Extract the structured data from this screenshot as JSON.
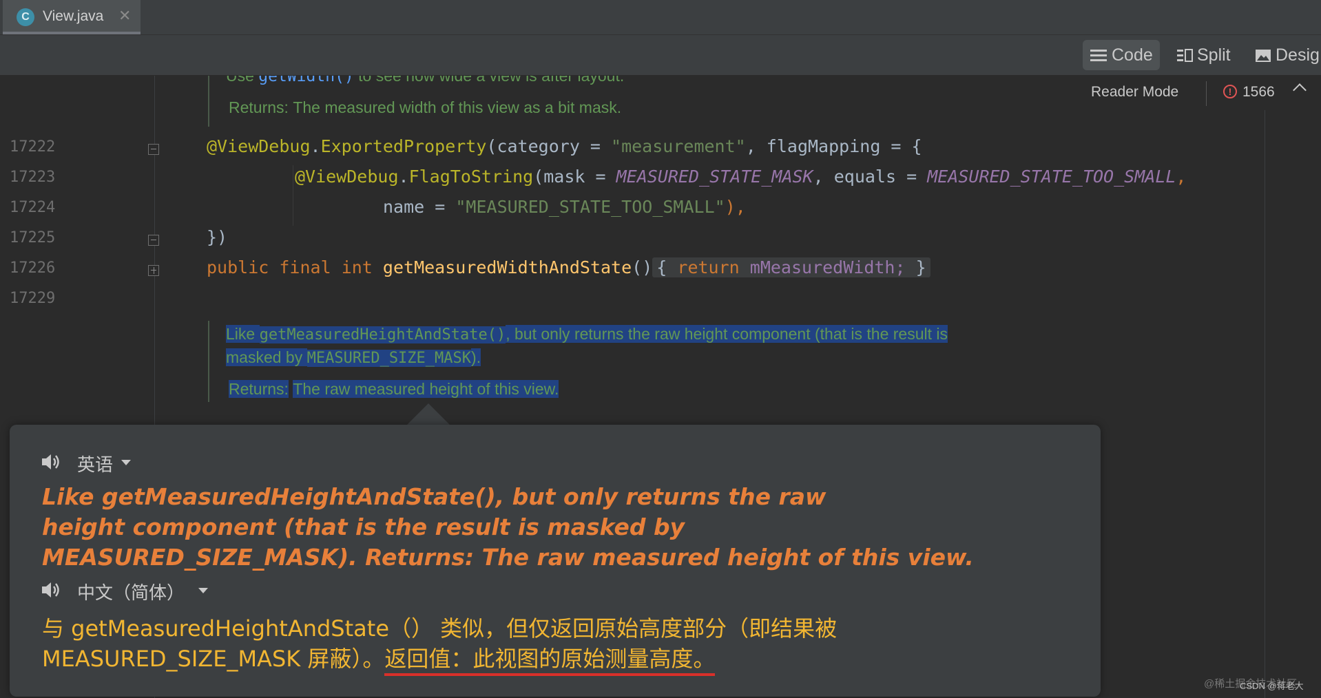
{
  "tab": {
    "icon_letter": "C",
    "label": "View.java",
    "close": "✕"
  },
  "toolbar": {
    "code": "Code",
    "split": "Split",
    "design": "Desig"
  },
  "editor": {
    "reader_mode": "Reader Mode",
    "problems_count": "1566",
    "line_numbers": [
      "17222",
      "17223",
      "17224",
      "17225",
      "17226",
      "17229"
    ],
    "doc_top": {
      "line1_pre": "Use ",
      "line1_link": "getWidth()",
      "line1_post": " to see how wide a view is after layout.",
      "returns_label": "Returns:",
      "returns_text": "The measured width of this view as a bit mask."
    },
    "code": {
      "l1_ann": "@ViewDebug",
      "l1_dot": ".",
      "l1_annname": "ExportedProperty",
      "l1_a": "(category = ",
      "l1_str": "\"measurement\"",
      "l1_b": ", flagMapping = {",
      "l2_ann": "@ViewDebug",
      "l2_dot": ".",
      "l2_annname": "FlagToString",
      "l2_a": "(mask = ",
      "l2_c1": "MEASURED_STATE_MASK",
      "l2_b": ", equals = ",
      "l2_c2": "MEASURED_STATE_TOO_SMALL",
      "l2_c": ",",
      "l3_a": "name = ",
      "l3_str": "\"MEASURED_STATE_TOO_SMALL\"",
      "l3_b": "),",
      "l4": "})",
      "l5_kw1": "public",
      "l5_kw2": "final",
      "l5_kw3": "int",
      "l5_fn": "getMeasuredWidthAndState",
      "l5_parens": "()",
      "l5_open": "{",
      "l5_kw4": "return",
      "l5_fld": "mMeasuredWidth;",
      "l5_close": "}"
    },
    "doc_selected": {
      "l1_a": "Like ",
      "l1_mono": "getMeasuredHeightAndState()",
      "l1_b": ", but only returns the raw height component (that is the result is",
      "l2_a": "masked by ",
      "l2_mono": "MEASURED_SIZE_MASK",
      "l2_b": ").",
      "returns_label": "Returns:",
      "returns_text": "The raw measured height of this view."
    }
  },
  "popup": {
    "source_lang": "英语",
    "source_text": [
      "Like getMeasuredHeightAndState(), but only returns the raw",
      "height component (that is the result is masked by",
      "MEASURED_SIZE_MASK). Returns: The raw measured height of this view."
    ],
    "target_lang": "中文（简体）",
    "target_line1": "与 getMeasuredHeightAndState（） 类似，但仅返回原始高度部分（即结果被",
    "target_line2_a": "MEASURED_SIZE_MASK 屏蔽）。",
    "target_line2_underlined": "返回值：此视图的原始测量高度。"
  },
  "watermark": {
    "back": "@稀土掘金技术社区",
    "front": "CSDN @蒋老大"
  }
}
